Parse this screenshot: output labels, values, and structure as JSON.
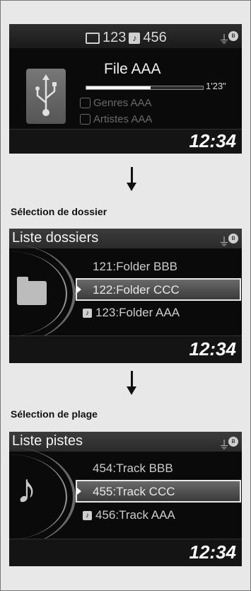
{
  "player": {
    "folder_count": "123",
    "track_count": "456",
    "file_name": "File AAA",
    "elapsed": "1'23\"",
    "progress": 0.55,
    "genre": "Genres AAA",
    "artist": "Artistes AAA",
    "clock": "12:34",
    "icons": {
      "folder": "folder-icon",
      "track": "music-note-icon",
      "usb": "usb-icon",
      "genre": "genre-icon",
      "artist": "artist-icon"
    }
  },
  "captions": {
    "folder_selection": "Sélection de dossier",
    "track_selection": "Sélection de plage"
  },
  "folder_list": {
    "title": "Liste dossiers",
    "items": [
      "121:Folder BBB",
      "122:Folder CCC",
      "123:Folder AAA"
    ],
    "selected_index": 1,
    "clock": "12:34"
  },
  "track_list": {
    "title": "Liste pistes",
    "items": [
      "454:Track BBB",
      "455:Track CCC",
      "456:Track AAA"
    ],
    "selected_index": 1,
    "clock": "12:34"
  }
}
